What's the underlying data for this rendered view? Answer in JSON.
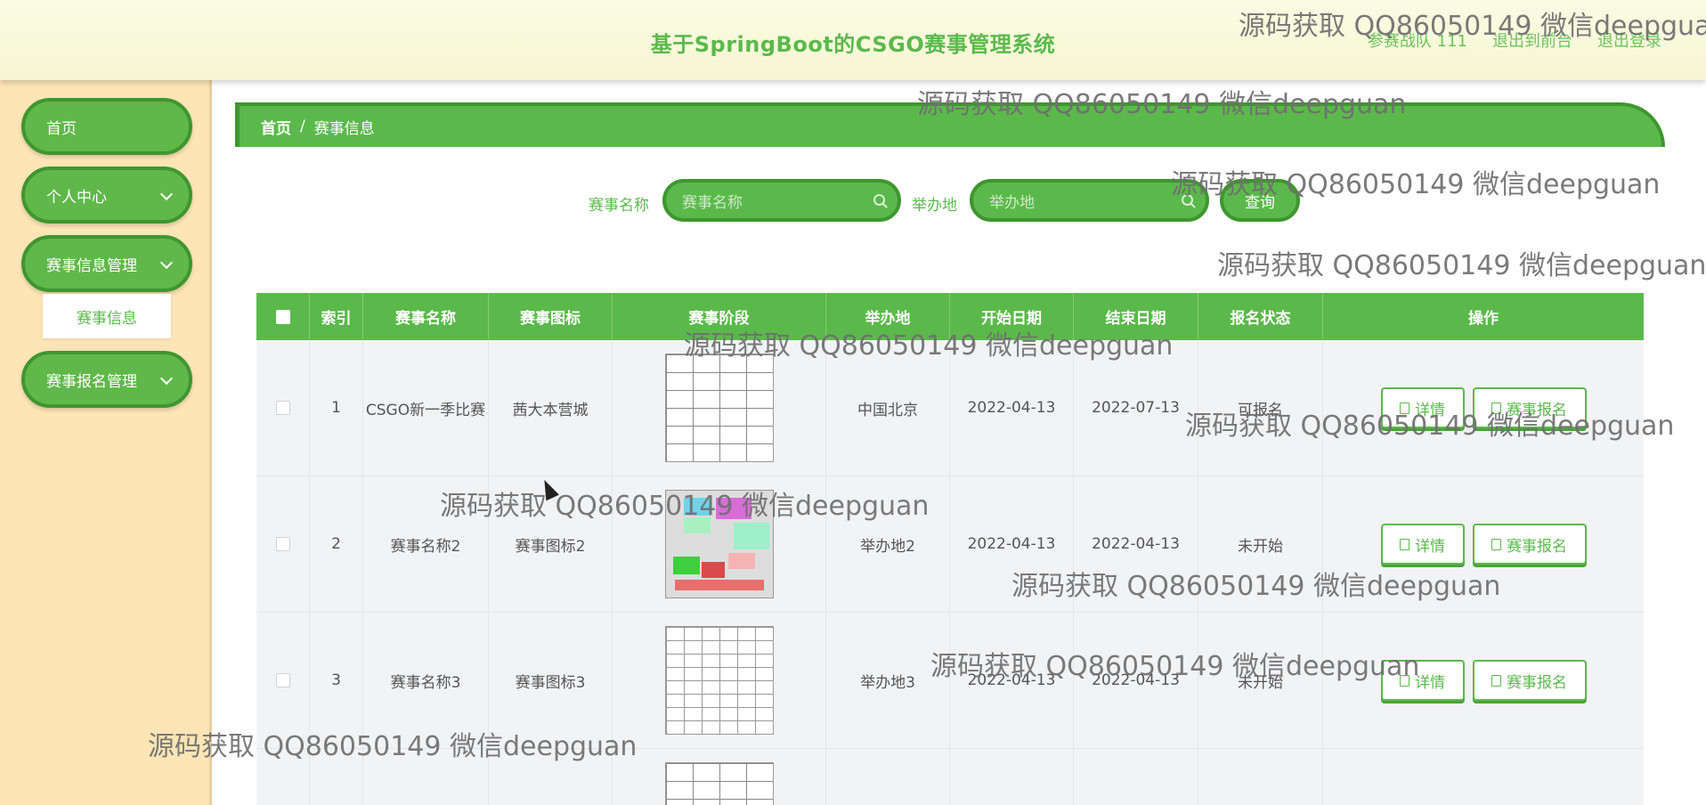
{
  "header": {
    "title": "基于SpringBoot的CSGO赛事管理系统",
    "user": "参赛战队 111",
    "front_link": "退出到前台",
    "logout_link": "退出登录"
  },
  "sidebar": {
    "items": [
      {
        "label": "首页"
      },
      {
        "label": "个人中心"
      },
      {
        "label": "赛事信息管理"
      },
      {
        "label": "赛事报名管理"
      }
    ],
    "submenu_active": "赛事信息"
  },
  "breadcrumb": {
    "home": "首页",
    "sep": "/",
    "current": "赛事信息"
  },
  "search": {
    "name_label": "赛事名称",
    "name_placeholder": "赛事名称",
    "place_label": "举办地",
    "place_placeholder": "举办地",
    "button": "查询"
  },
  "table": {
    "headers": [
      "索引",
      "赛事名称",
      "赛事图标",
      "赛事阶段",
      "举办地",
      "开始日期",
      "结束日期",
      "报名状态",
      "操作"
    ],
    "rows": [
      {
        "index": "1",
        "name": "CSGO新一季比赛",
        "icon": "茜大本营城",
        "place": "中国北京",
        "start": "2022-04-13",
        "end": "2022-07-13",
        "status": "可报名"
      },
      {
        "index": "2",
        "name": "赛事名称2",
        "icon": "赛事图标2",
        "place": "举办地2",
        "start": "2022-04-13",
        "end": "2022-04-13",
        "status": "未开始"
      },
      {
        "index": "3",
        "name": "赛事名称3",
        "icon": "赛事图标3",
        "place": "举办地3",
        "start": "2022-04-13",
        "end": "2022-04-13",
        "status": "未开始"
      }
    ],
    "detail_label": "详情",
    "signup_label": "赛事报名"
  },
  "watermark": "源码获取 QQ86050149 微信deepguan",
  "colors": {
    "primary": "#5bb94b",
    "primary_dark": "#3f962f",
    "sidebar_bg": "#fde5b6",
    "header_bg": "#fbfbe4"
  }
}
